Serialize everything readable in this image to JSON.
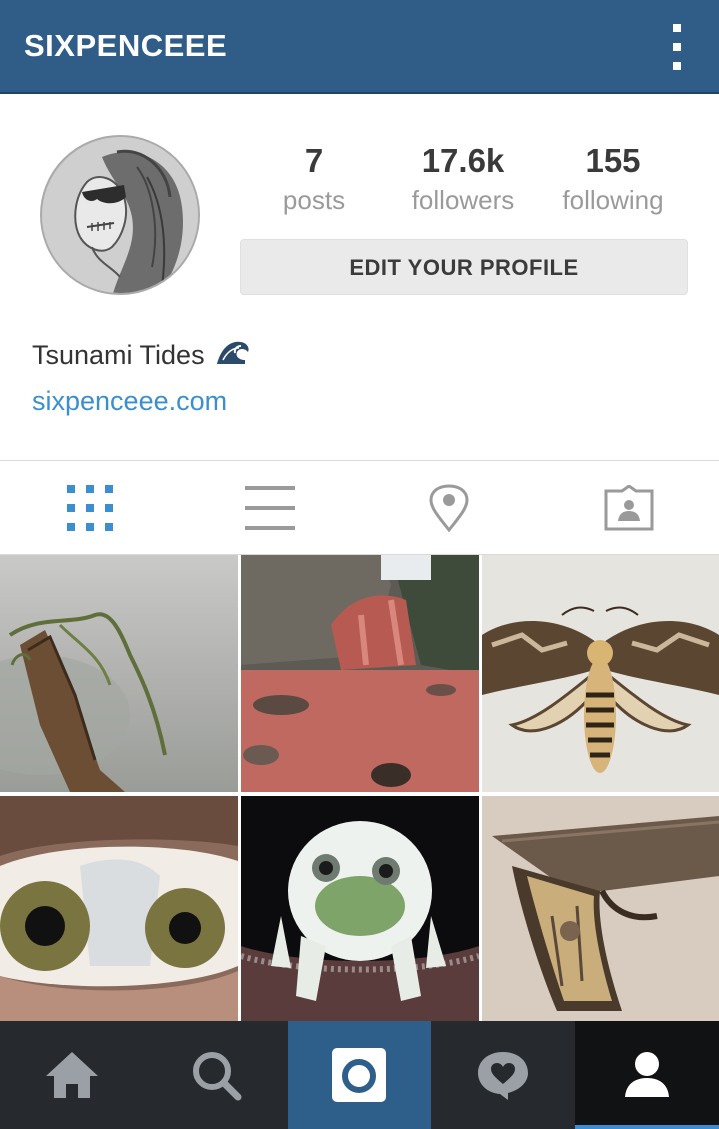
{
  "header": {
    "username": "SIXPENCEEE"
  },
  "profile": {
    "stats": [
      {
        "value": "7",
        "label": "posts"
      },
      {
        "value": "17.6k",
        "label": "followers"
      },
      {
        "value": "155",
        "label": "following"
      }
    ],
    "edit_label": "EDIT YOUR PROFILE",
    "full_name": "Tsunami Tides",
    "website": "sixpenceee.com"
  },
  "tabs": [
    {
      "icon": "grid-icon",
      "selected": true
    },
    {
      "icon": "list-icon",
      "selected": false
    },
    {
      "icon": "location-pin-icon",
      "selected": false
    },
    {
      "icon": "tagged-photos-icon",
      "selected": false
    }
  ],
  "colors": {
    "brand": "#2f5d87",
    "accent": "#3c8fcf",
    "nav_bg": "#262a2f"
  },
  "grid_photos": [
    {
      "subject": "mossy branch in fog"
    },
    {
      "subject": "red river waterfall"
    },
    {
      "subject": "deaths head moth"
    },
    {
      "subject": "eye with two pupils"
    },
    {
      "subject": "frost covered frog"
    },
    {
      "subject": "pistol with photo grip"
    }
  ],
  "bottom_nav": [
    {
      "icon": "home-icon"
    },
    {
      "icon": "search-icon"
    },
    {
      "icon": "camera-icon"
    },
    {
      "icon": "activity-heart-icon"
    },
    {
      "icon": "profile-icon"
    }
  ]
}
